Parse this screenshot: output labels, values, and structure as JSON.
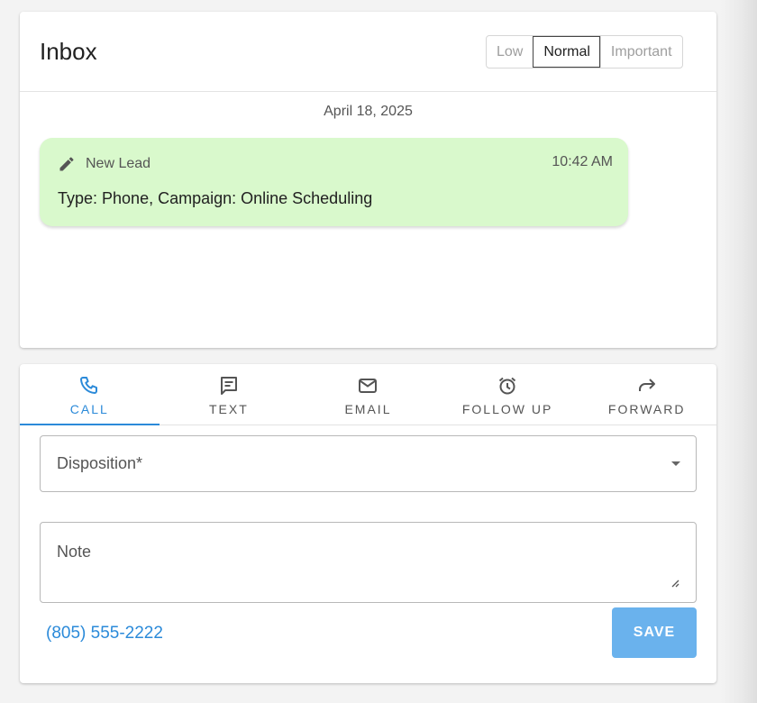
{
  "inbox": {
    "title": "Inbox",
    "priority": [
      "Low",
      "Normal",
      "Important"
    ],
    "selected_priority": "Normal",
    "date": "April 18, 2025",
    "message": {
      "icon": "pencil-icon",
      "type": "New Lead",
      "time": "10:42 AM",
      "body": "Type: Phone, Campaign: Online Scheduling",
      "background": "#d9f9cc"
    }
  },
  "actions": {
    "tabs": [
      {
        "label": "CALL",
        "icon": "phone-icon"
      },
      {
        "label": "TEXT",
        "icon": "chat-icon"
      },
      {
        "label": "EMAIL",
        "icon": "email-icon"
      },
      {
        "label": "FOLLOW UP",
        "icon": "alarm-icon"
      },
      {
        "label": "FORWARD",
        "icon": "forward-icon"
      }
    ],
    "active_tab": "CALL",
    "disposition_label": "Disposition*",
    "note_label": "Note",
    "phone": "(805) 555-2222",
    "save_label": "SAVE"
  },
  "colors": {
    "accent": "#2b8ad9",
    "save_button": "#6ab2ed"
  }
}
